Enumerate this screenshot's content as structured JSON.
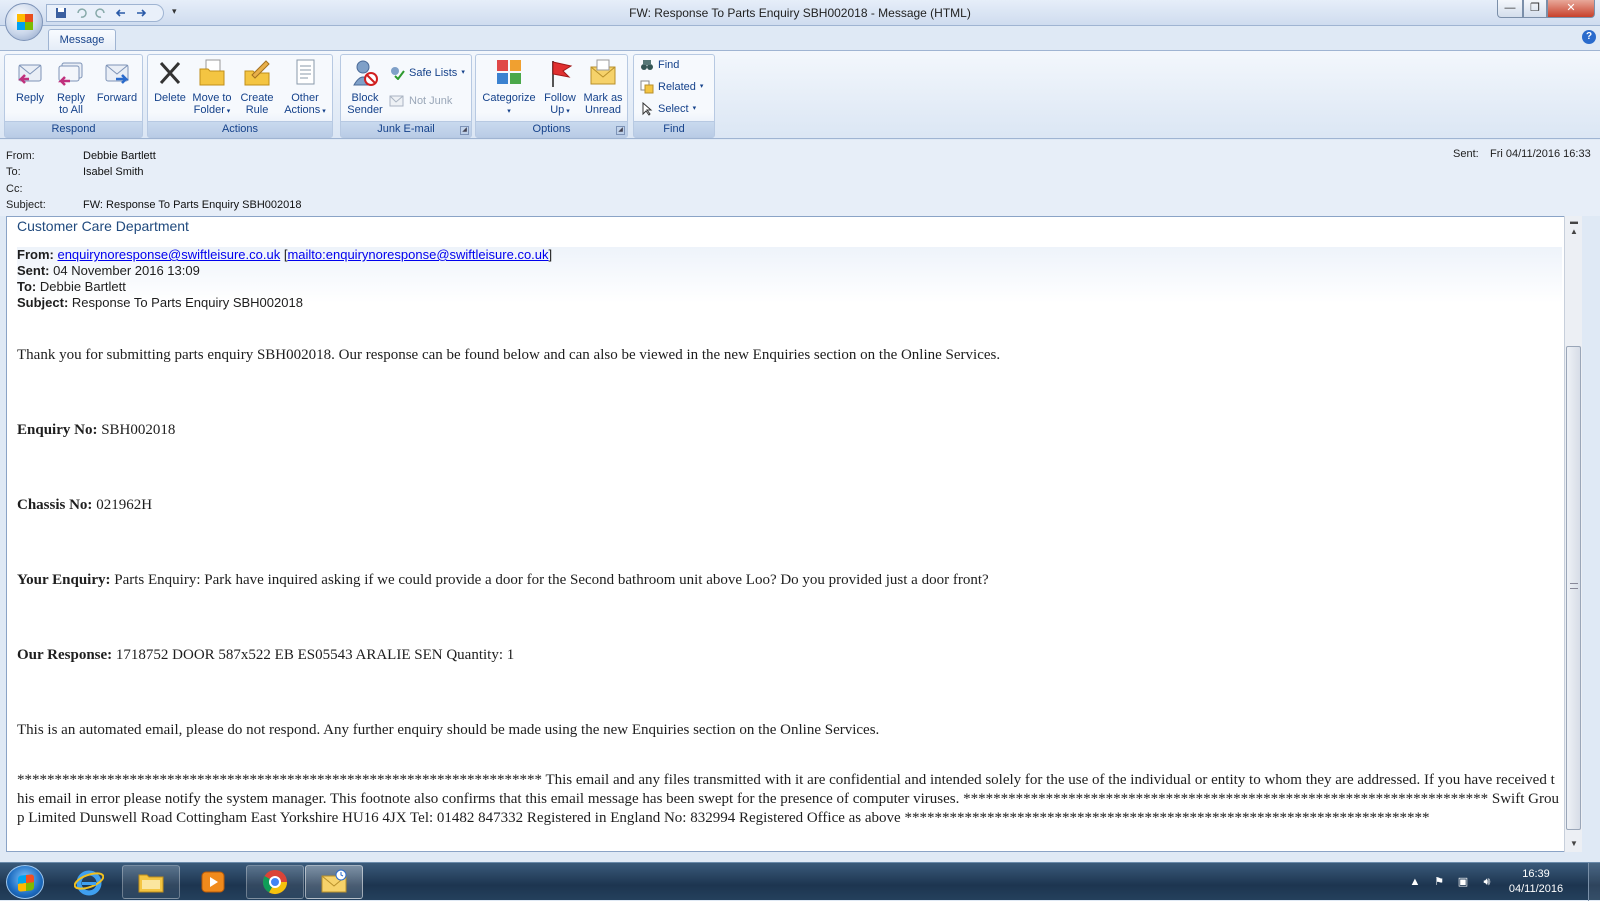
{
  "window": {
    "title": "FW: Response To Parts Enquiry SBH002018 - Message (HTML)",
    "minimize": "—",
    "maximize": "❐",
    "close": "✕"
  },
  "ribbon": {
    "tab": "Message",
    "help": "?",
    "groups": {
      "respond": {
        "label": "Respond",
        "reply": "Reply",
        "reply_all_1": "Reply",
        "reply_all_2": "to All",
        "forward": "Forward"
      },
      "actions": {
        "label": "Actions",
        "delete": "Delete",
        "move_1": "Move to",
        "move_2": "Folder",
        "rule_1": "Create",
        "rule_2": "Rule",
        "other_1": "Other",
        "other_2": "Actions"
      },
      "junk": {
        "label": "Junk E-mail",
        "block_1": "Block",
        "block_2": "Sender",
        "safe_lists": "Safe Lists",
        "not_junk": "Not Junk"
      },
      "options": {
        "label": "Options",
        "categorize": "Categorize",
        "follow_1": "Follow",
        "follow_2": "Up",
        "mark_1": "Mark as",
        "mark_2": "Unread"
      },
      "find": {
        "label": "Find",
        "find": "Find",
        "related": "Related",
        "select": "Select"
      }
    }
  },
  "header": {
    "from_label": "From:",
    "from": "Debbie Bartlett",
    "to_label": "To:",
    "to": "Isabel Smith",
    "cc_label": "Cc:",
    "cc": "",
    "subject_label": "Subject:",
    "subject": "FW: Response To Parts Enquiry SBH002018",
    "sent_label": "Sent:",
    "sent": "Fri 04/11/2016 16:33"
  },
  "body": {
    "department": "Customer Care Department",
    "fwd": {
      "from_label": "From:",
      "from_email": "enquirynoresponse@swiftleisure.co.uk",
      "mailto": "mailto:enquirynoresponse@swiftleisure.co.uk",
      "sent_label": "Sent:",
      "sent": "04 November 2016 13:09",
      "to_label": "To:",
      "to": "Debbie Bartlett",
      "subject_label": "Subject:",
      "subject": "Response To Parts Enquiry SBH002018"
    },
    "thanks": "Thank you for submitting parts enquiry SBH002018. Our response can be found below and can also be viewed in the new Enquiries section on the Online Services.",
    "enquiry_label": "Enquiry No:",
    "enquiry_no": "SBH002018",
    "chassis_label": "Chassis No:",
    "chassis_no": "021962H",
    "your_enquiry_label": "Your Enquiry:",
    "your_enquiry": "Parts Enquiry: Park have inquired asking if we could provide a door for the Second bathroom unit above Loo? Do you provided just a door front?",
    "response_label": "Our Response:",
    "response": "1718752 DOOR 587x522 EB ES05543 ARALIE SEN Quantity: 1",
    "automated": "This is an automated email, please do not respond. Any further enquiry should be made using the new Enquiries section on the Online Services.",
    "footer": "********************************************************************** This email and any files transmitted with it are confidential and intended solely for the use of the individual or entity to whom they are addressed. If you have received this email in error please notify the system manager. This footnote also confirms that this email message has been swept for the presence of computer viruses. ********************************************************************** Swift Group Limited Dunswell Road Cottingham East Yorkshire HU16 4JX Tel: 01482 847332 Registered in England No: 832994 Registered Office as above **********************************************************************"
  },
  "taskbar": {
    "apps": [
      "start-orb",
      "internet-explorer-icon",
      "file-explorer-icon",
      "media-player-icon",
      "chrome-icon",
      "outlook-icon"
    ],
    "time": "16:39",
    "date": "04/11/2016"
  },
  "colors": {
    "ribbon_text": "#15428b",
    "link": "#0000ee",
    "department": "#1f497d"
  }
}
